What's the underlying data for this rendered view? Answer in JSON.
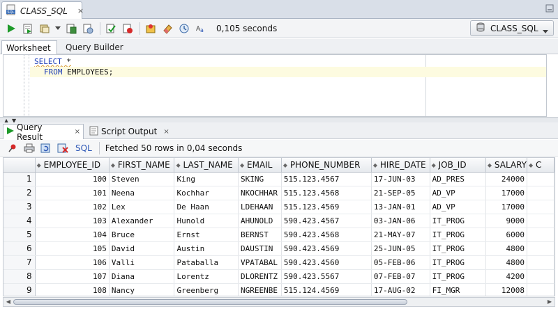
{
  "document_tab": {
    "title": "CLASS_SQL",
    "close": "×"
  },
  "toolbar": {
    "elapsed": "0,105 seconds",
    "connection": "CLASS_SQL"
  },
  "worksheet_tabs": [
    "Worksheet",
    "Query Builder"
  ],
  "editor": {
    "line1_kw": "SELECT",
    "line1_rest": " *",
    "line2_kw": "FROM",
    "line2_rest": " EMPLOYEES;"
  },
  "result_tabs": [
    {
      "label": "Query Result",
      "close": "×"
    },
    {
      "label": "Script Output",
      "close": "×"
    }
  ],
  "result_toolbar": {
    "sql_label": "SQL",
    "status": "Fetched 50 rows in 0,04 seconds"
  },
  "grid": {
    "columns": [
      "EMPLOYEE_ID",
      "FIRST_NAME",
      "LAST_NAME",
      "EMAIL",
      "PHONE_NUMBER",
      "HIRE_DATE",
      "JOB_ID",
      "SALARY",
      "C"
    ],
    "rows": [
      [
        "1",
        "100",
        "Steven",
        "King",
        "SKING",
        "515.123.4567",
        "17-JUN-03",
        "AD_PRES",
        "24000",
        ""
      ],
      [
        "2",
        "101",
        "Neena",
        "Kochhar",
        "NKOCHHAR",
        "515.123.4568",
        "21-SEP-05",
        "AD_VP",
        "17000",
        ""
      ],
      [
        "3",
        "102",
        "Lex",
        "De Haan",
        "LDEHAAN",
        "515.123.4569",
        "13-JAN-01",
        "AD_VP",
        "17000",
        ""
      ],
      [
        "4",
        "103",
        "Alexander",
        "Hunold",
        "AHUNOLD",
        "590.423.4567",
        "03-JAN-06",
        "IT_PROG",
        "9000",
        ""
      ],
      [
        "5",
        "104",
        "Bruce",
        "Ernst",
        "BERNST",
        "590.423.4568",
        "21-MAY-07",
        "IT_PROG",
        "6000",
        ""
      ],
      [
        "6",
        "105",
        "David",
        "Austin",
        "DAUSTIN",
        "590.423.4569",
        "25-JUN-05",
        "IT_PROG",
        "4800",
        ""
      ],
      [
        "7",
        "106",
        "Valli",
        "Pataballa",
        "VPATABAL",
        "590.423.4560",
        "05-FEB-06",
        "IT_PROG",
        "4800",
        ""
      ],
      [
        "8",
        "107",
        "Diana",
        "Lorentz",
        "DLORENTZ",
        "590.423.5567",
        "07-FEB-07",
        "IT_PROG",
        "4200",
        ""
      ],
      [
        "9",
        "108",
        "Nancy",
        "Greenberg",
        "NGREENBE",
        "515.124.4569",
        "17-AUG-02",
        "FI_MGR",
        "12008",
        ""
      ]
    ]
  },
  "colors": {
    "keyword": "#1f3fb8",
    "link": "#2a55b5",
    "run_green": "#1e9a2a"
  }
}
